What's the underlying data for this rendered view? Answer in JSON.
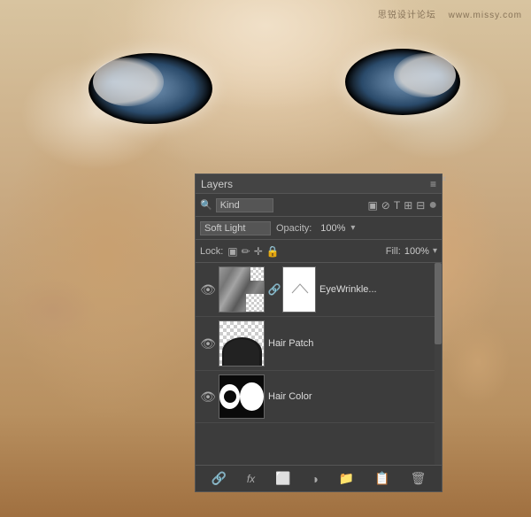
{
  "watermark": {
    "text1": "思锐设计论坛",
    "text2": "www.missy.com"
  },
  "panel": {
    "title": "Layers",
    "collapse_icon": "«",
    "menu_icon": "≡",
    "filter": {
      "search_placeholder": "Kind",
      "kind_label": "Kind",
      "icons": [
        "▣",
        "⊘",
        "T",
        "⊞",
        "⊟",
        "●"
      ]
    },
    "blend": {
      "mode": "Soft Light",
      "opacity_label": "Opacity:",
      "opacity_value": "100%"
    },
    "lock": {
      "label": "Lock:",
      "icons": [
        "▣",
        "✏",
        "↔",
        "🔒"
      ],
      "fill_label": "Fill:",
      "fill_value": "100%"
    },
    "layers": [
      {
        "name": "EyeWrinkle...",
        "visible": true,
        "has_mask": true,
        "has_link": true,
        "thumb_type": "eyewrinkle"
      },
      {
        "name": "Hair Patch",
        "visible": true,
        "has_mask": false,
        "has_link": false,
        "thumb_type": "hair"
      },
      {
        "name": "Hair Color",
        "visible": true,
        "has_mask": false,
        "has_link": false,
        "thumb_type": "black_circle"
      }
    ],
    "bottom_icons": [
      "link",
      "fx",
      "mask",
      "adjustment",
      "folder",
      "new-layer",
      "delete"
    ]
  }
}
